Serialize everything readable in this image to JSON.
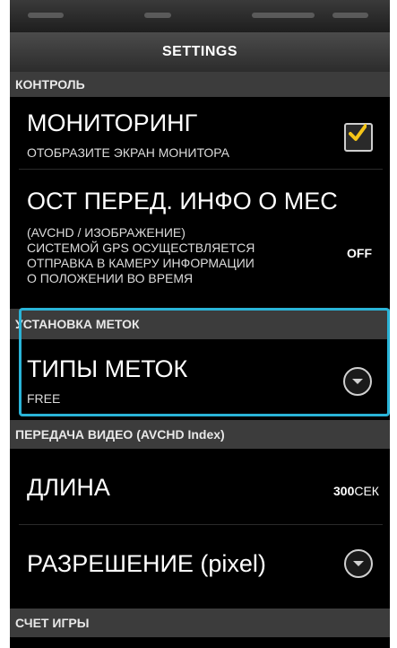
{
  "header": {
    "title": "SETTINGS"
  },
  "sections": {
    "control": "КОНТРОЛЬ",
    "marks": "УСТАНОВКА МЕТОК",
    "video": "ПЕРЕДАЧА ВИДЕО (AVCHD Index)",
    "game": "СЧЕТ ИГРЫ"
  },
  "monitoring": {
    "title": "МОНИТОРИНГ",
    "subtitle": "ОТОБРАЗИТЕ ЭКРАН МОНИТОРА",
    "checked": true
  },
  "gps": {
    "title": "ОСТ ПЕРЕД. ИНФО О МЕС",
    "subtitle": "(AVCHD / ИЗОБРАЖЕНИЕ)\nСИСТЕМОЙ GPS ОСУЩЕСТВЛЯЕТСЯ\nОТПРАВКА В КАМЕРУ ИНФОРМАЦИИ\nО ПОЛОЖЕНИИ ВО ВРЕМЯ",
    "value": "OFF"
  },
  "mark_types": {
    "title": "ТИПЫ МЕТОК",
    "subtitle": "FREE"
  },
  "length": {
    "title": "ДЛИНА",
    "value_number": "300",
    "value_unit": "СЕК"
  },
  "resolution": {
    "title": "РАЗРЕШЕНИЕ (pixel)"
  },
  "colors": {
    "highlight": "#2ab4d8",
    "check": "#f5c518",
    "section_bg": "#3c3c3c"
  },
  "icons": [
    "checkbox-icon",
    "chevron-down-icon"
  ]
}
